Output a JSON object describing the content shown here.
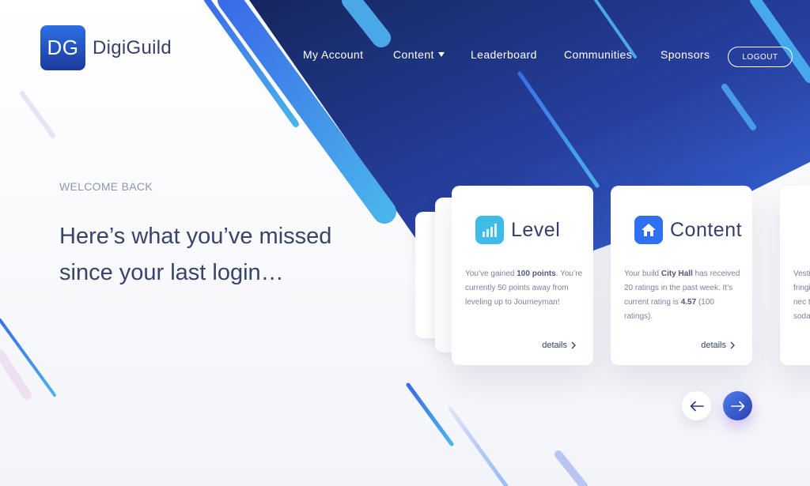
{
  "brand": {
    "mark": "DG",
    "name": "DigiGuild"
  },
  "nav": {
    "items": [
      "My Account",
      "Content",
      "Leaderboard",
      "Communities",
      "Sponsors"
    ],
    "logout": "LOGOUT"
  },
  "hero": {
    "eyebrow": "WELCOME BACK",
    "headline_line1": "Here’s what you’ve missed",
    "headline_line2": "since your last login…"
  },
  "cards": [
    {
      "title": "Level",
      "icon": "bar-chart-icon",
      "icon_color": "#3fb9e6",
      "body_1": "You’ve gained ",
      "body_bold_1": "100 points",
      "body_2": ". You’re currently 50 points away from leveling up to Journeyman!",
      "details": "details"
    },
    {
      "title": "Content",
      "icon": "home-icon",
      "icon_color": "#2f6ff0",
      "body_1": "Your build ",
      "body_bold_1": "City Hall",
      "body_2": " has received 20 ratings in the past week. It’s current rating is ",
      "body_bold_2": "4.57",
      "body_3": " (100 ratings).",
      "details": "details"
    }
  ],
  "partial_card": {
    "lines": [
      "Vesti",
      "fringi",
      "nec t",
      "soda"
    ]
  },
  "carousel": {
    "prev_icon": "arrow-left-icon",
    "next_icon": "arrow-right-icon"
  },
  "colors": {
    "accent_dark": "#1b2b6e",
    "accent": "#2f5ee0",
    "accent_light": "#4aa8e8"
  }
}
